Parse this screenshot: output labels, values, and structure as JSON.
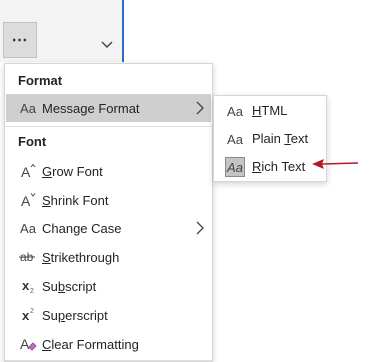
{
  "toolbar": {
    "more_button": "⋯",
    "chevron_icon": "chevron-down-icon"
  },
  "menu": {
    "format_header": "Format",
    "message_format": {
      "icon": "Aa",
      "label": "Message Format"
    },
    "font_header": "Font",
    "items": [
      {
        "icon": "grow-font-icon",
        "glyph": "A",
        "label": "Grow Font",
        "ul": "G",
        "rest": "row Font"
      },
      {
        "icon": "shrink-font-icon",
        "glyph": "A",
        "label": "Shrink Font",
        "ul": "S",
        "rest": "hrink Font"
      },
      {
        "icon": "change-case-icon",
        "glyph": "Aa",
        "label": "Change Case",
        "ul": "",
        "rest": "Change Case"
      },
      {
        "icon": "strikethrough-icon",
        "glyph": "ab",
        "label": "Strikethrough",
        "ul": "S",
        "rest": "trikethrough"
      },
      {
        "icon": "subscript-icon",
        "glyph": "x",
        "label": "Subscript",
        "ul": "b",
        "pre": "Su",
        "rest": "script"
      },
      {
        "icon": "superscript-icon",
        "glyph": "x",
        "label": "Superscript",
        "ul": "p",
        "pre": "Su",
        "rest": "erscript"
      },
      {
        "icon": "clear-formatting-icon",
        "glyph": "A",
        "label": "Clear Formatting",
        "ul": "C",
        "rest": "lear Formatting"
      }
    ]
  },
  "submenu": {
    "items": [
      {
        "icon": "Aa",
        "pre": "",
        "ul": "H",
        "rest": "TML",
        "selected": false
      },
      {
        "icon": "Aa",
        "pre": "Plain ",
        "ul": "T",
        "rest": "ext",
        "selected": false
      },
      {
        "icon": "Aa",
        "pre": "",
        "ul": "R",
        "rest": "ich Text",
        "selected": true
      }
    ]
  },
  "colors": {
    "highlight": "#cfcfcf",
    "annotation_arrow": "#b01c23",
    "toolbar_accent": "#2b6cc4"
  }
}
